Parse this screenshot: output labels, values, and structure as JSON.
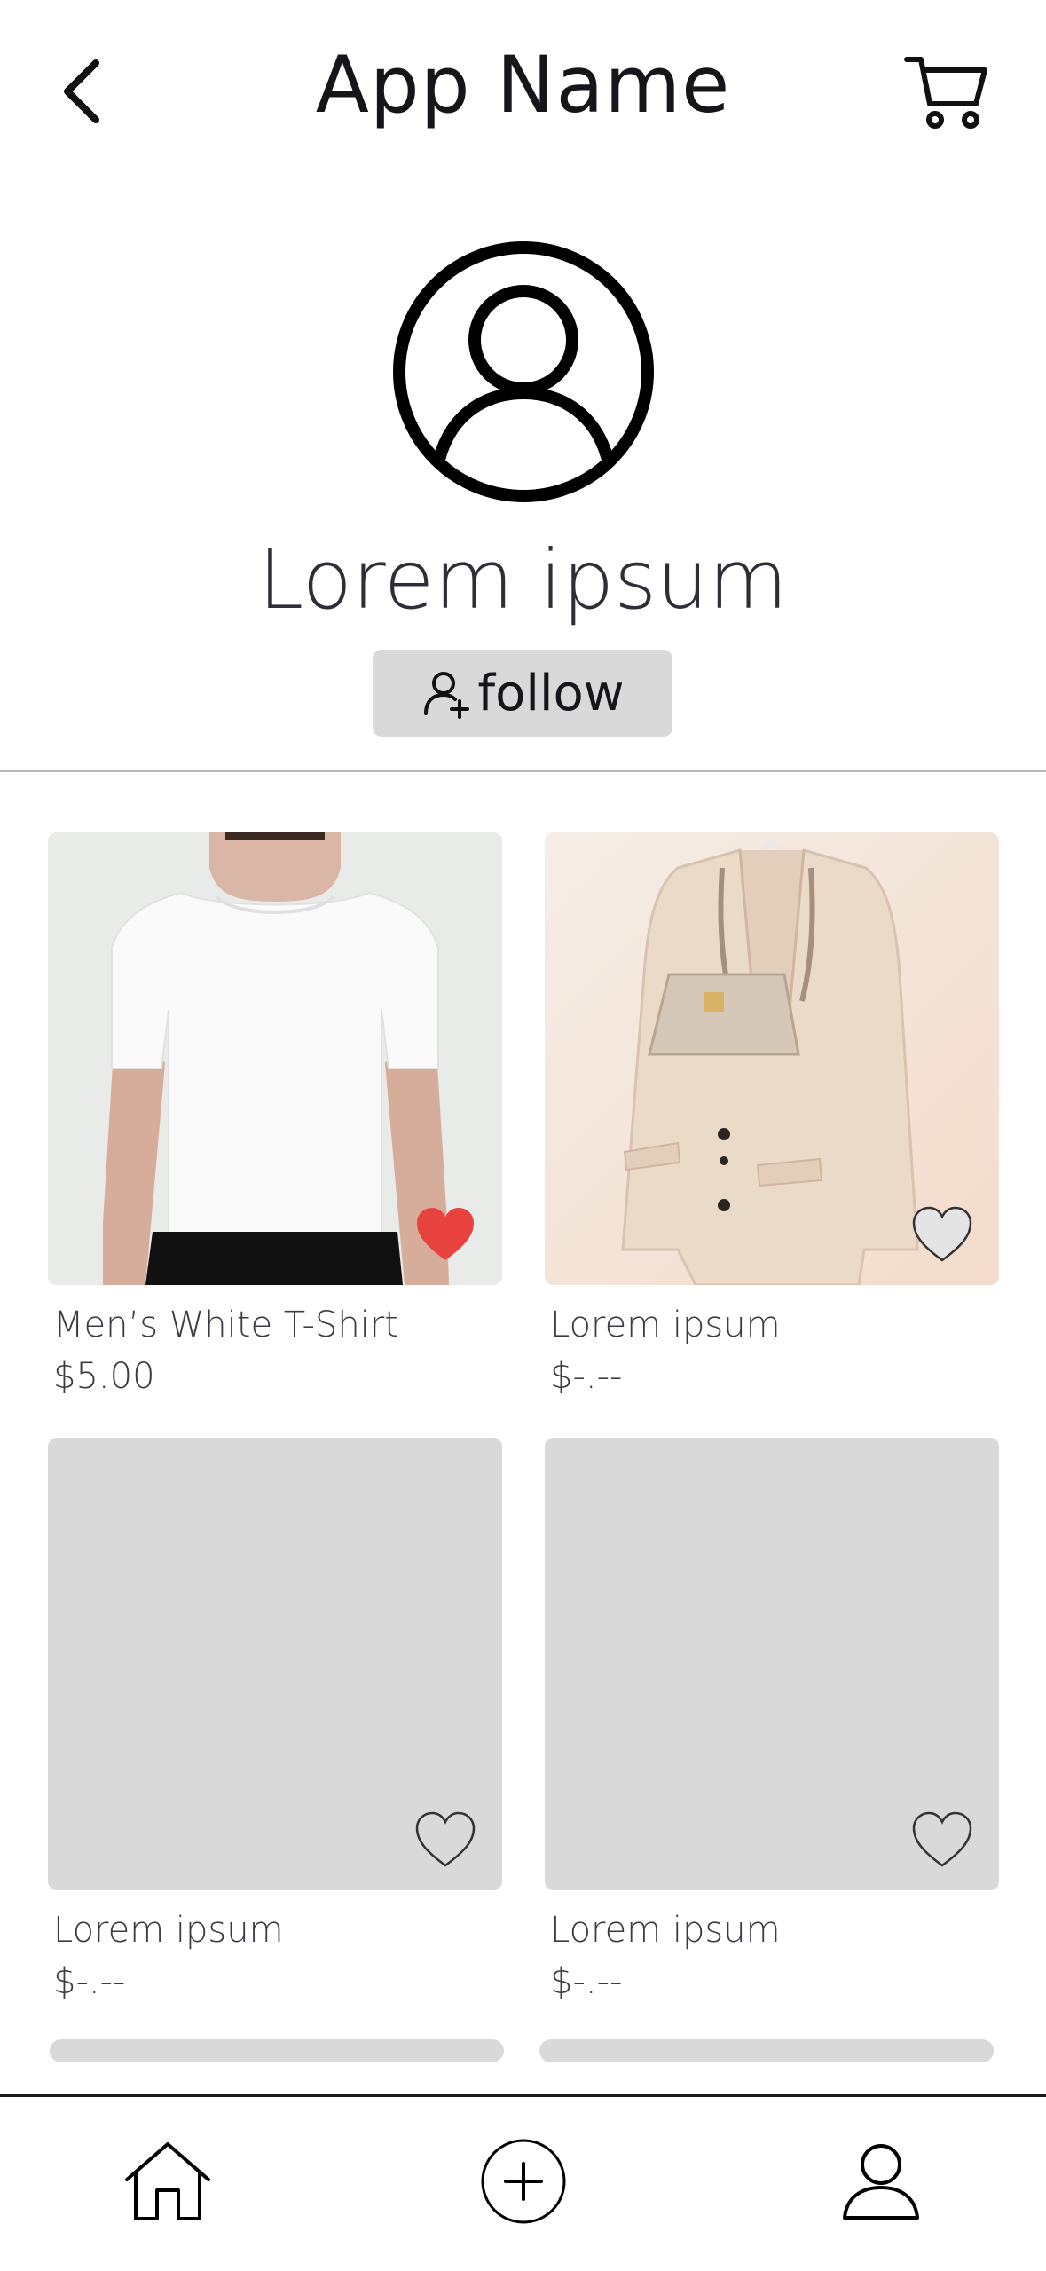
{
  "header": {
    "title": "App Name",
    "back_icon": "chevron-left-icon",
    "cart_icon": "cart-icon"
  },
  "profile": {
    "avatar_icon": "user-circle-icon",
    "name": "Lorem ipsum",
    "follow_label": "follow",
    "follow_icon": "user-plus-icon"
  },
  "products": [
    {
      "title": "Men’s White T-Shirt",
      "price": "$5.00",
      "favorited": true,
      "image": "photo-white-tshirt"
    },
    {
      "title": "Lorem ipsum",
      "price": "$-.--",
      "favorited": false,
      "image": "photo-beige-coat-with-bag"
    },
    {
      "title": "Lorem ipsum",
      "price": "$-.--",
      "favorited": false,
      "image": "placeholder"
    },
    {
      "title": "Lorem ipsum",
      "price": "$-.--",
      "favorited": false,
      "image": "placeholder"
    }
  ],
  "tabbar": {
    "items": [
      {
        "name": "home",
        "icon": "home-icon"
      },
      {
        "name": "add",
        "icon": "plus-circle-icon"
      },
      {
        "name": "profile",
        "icon": "user-icon"
      }
    ]
  },
  "colors": {
    "favorite_active": "#e8423f",
    "placeholder": "#d9d9d9",
    "text": "#2b2b33"
  }
}
